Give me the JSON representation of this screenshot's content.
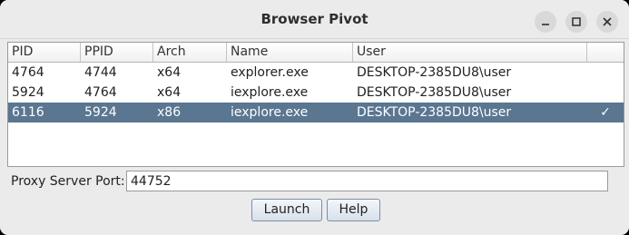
{
  "window": {
    "title": "Browser Pivot",
    "controls": [
      "minimize-icon",
      "maximize-icon",
      "close-icon"
    ]
  },
  "table": {
    "columns": [
      "PID",
      "PPID",
      "Arch",
      "Name",
      "User",
      ""
    ],
    "rows": [
      {
        "pid": "4764",
        "ppid": "4744",
        "arch": "x64",
        "name": "explorer.exe",
        "user": "DESKTOP-2385DU8\\user",
        "check": "",
        "selected": false
      },
      {
        "pid": "5924",
        "ppid": "4764",
        "arch": "x64",
        "name": "iexplore.exe",
        "user": "DESKTOP-2385DU8\\user",
        "check": "",
        "selected": false
      },
      {
        "pid": "6116",
        "ppid": "5924",
        "arch": "x86",
        "name": "iexplore.exe",
        "user": "DESKTOP-2385DU8\\user",
        "check": "✓",
        "selected": true
      }
    ]
  },
  "proxy": {
    "label": "Proxy Server Port:",
    "value": "44752"
  },
  "buttons": {
    "launch_label": "Launch",
    "help_label": "Help"
  },
  "colors": {
    "selection": "#5a7691",
    "background": "#ebebeb"
  }
}
